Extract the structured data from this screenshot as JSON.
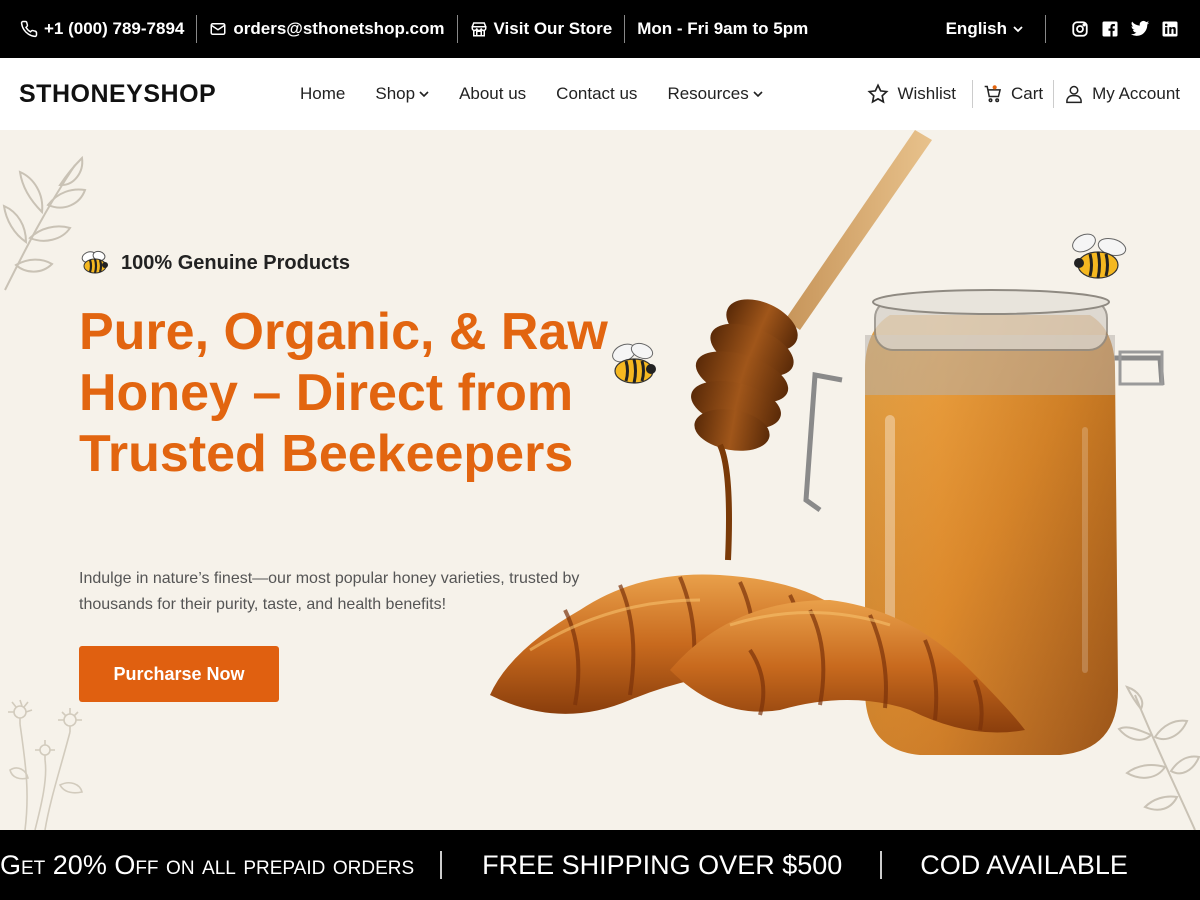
{
  "topbar": {
    "phone": "+1 (000) 789-7894",
    "email": "orders@sthonetshop.com",
    "store": "Visit Our Store",
    "hours": "Mon - Fri 9am to 5pm",
    "language": "English"
  },
  "header": {
    "logo": "STHONEYSHOP",
    "nav": {
      "home": "Home",
      "shop": "Shop",
      "about": "About us",
      "contact": "Contact us",
      "resources": "Resources"
    },
    "wishlist": "Wishlist",
    "cart": "Cart",
    "account": "My Account"
  },
  "hero": {
    "badge": "100% Genuine Products",
    "headline": "Pure, Organic, & Raw Honey – Direct from Trusted Beekeepers",
    "subtext": "Indulge in nature’s finest—our most popular honey varieties, trusted by thousands for their purity, taste, and health benefits!",
    "cta": "Purcharse Now"
  },
  "promo": {
    "item1": "Get 20% Off on all prepaid orders",
    "item2": "FREE SHIPPING OVER $500",
    "item3": "COD AVAILABLE"
  },
  "colors": {
    "accent": "#e26510",
    "button": "#e06010",
    "bar": "#000000",
    "hero_bg": "#f6f2ea"
  },
  "icons": [
    "phone-icon",
    "mail-icon",
    "store-icon",
    "chevron-down-icon",
    "instagram-icon",
    "facebook-icon",
    "twitter-icon",
    "linkedin-icon",
    "star-icon",
    "cart-icon",
    "user-icon",
    "bee-icon"
  ]
}
